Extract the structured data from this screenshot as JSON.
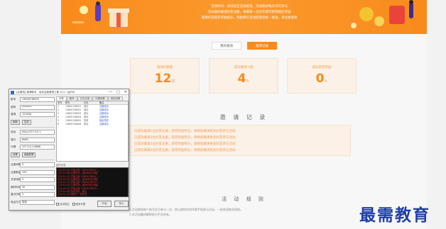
{
  "banner": {
    "lines": [
      "活动时间：即日起至活动结束，活动期间每天均可参与",
      "活动期间邀请好友注册，每邀请一位好友即可获得相应奖励",
      "邀请好友越多奖励越多，奖励将在活动结束后统一发放，请注意查收"
    ]
  },
  "tabs": [
    "我的邀请",
    "邀请记录"
  ],
  "stats": [
    {
      "label": "邀请码数量",
      "value": "12",
      "unit": "次"
    },
    {
      "label": "成功邀请人数",
      "value": "4",
      "unit": "人"
    },
    {
      "label": "成功获得奖励",
      "value": "0",
      "unit": "人"
    }
  ],
  "records_title": "邀 请 记 录",
  "records": [
    "已成功邀请1位好友注册，获得奖励积分，请继续邀请更多好友参与活动",
    "已成功邀请2位好友注册，获得奖励积分，请继续邀请更多好友参与活动",
    "已成功邀请3位好友注册，获得奖励积分，请继续邀请更多好友参与活动",
    "已成功邀请4位好友注册，获得奖励积分，请继续邀请更多好友参与活动"
  ],
  "system_title": "活 动 规 则",
  "system_lines": [
    "1.活动期间每个账号仅可参与一次，禁止使用任何作弊手段参与活动，一经发现取消资格。",
    "2.本活动最终解释权归平台所有。"
  ],
  "watermark": "最需教育",
  "window": {
    "title": "[注册机] 邀请助手 - 自动注册邀请工具 v1.0 - 运行中",
    "controls": [
      "—",
      "□",
      "✕"
    ],
    "fields": [
      {
        "k": "账号",
        "v": "13800138000"
      },
      {
        "k": "密码",
        "v": "********"
      },
      {
        "k": "邀请",
        "v": "123456"
      }
    ],
    "refresh_label": "刷新",
    "gen_label": "生成",
    "fields2": [
      {
        "k": "地址",
        "v": "http://127.0.0.1"
      },
      {
        "k": "端口",
        "v": "8080"
      }
    ],
    "proxy": {
      "k": "代理",
      "v": "127.0.0.1:8888"
    },
    "set_label": "设置",
    "config_label": "读取配置",
    "counts": [
      {
        "k": "注册间隔",
        "v": "3"
      },
      {
        "k": "注册数量",
        "v": "100"
      },
      {
        "k": "并发线程",
        "v": "5"
      },
      {
        "k": "超时时间",
        "v": "30"
      },
      {
        "k": "重试次数",
        "v": "3"
      },
      {
        "k": "验证方式",
        "v": "短信"
      }
    ],
    "tabs": [
      "列表",
      "账号",
      "日志记录",
      "代理设置",
      "其他设置"
    ],
    "grid_headers": [
      "序号",
      "账号",
      "状态",
      "备注"
    ],
    "grid_rows": [
      [
        "1",
        "13800138001",
        "成功",
        "注册成功"
      ],
      [
        "2",
        "13800138002",
        "成功",
        "注册成功"
      ],
      [
        "3",
        "13800138003",
        "成功",
        "注册成功"
      ],
      [
        "4",
        "13800138004",
        "成功",
        "注册成功"
      ],
      [
        "5",
        "13800138005",
        "失败",
        "验证失败"
      ],
      [
        "6",
        "13800138006",
        "成功",
        "注册成功"
      ]
    ],
    "log_label": "运行日志",
    "console_lines": [
      "[12:01:05] 开始注册 13800138001 ...",
      "[12:01:08] 注册成功，邀请关系已绑定",
      "[12:01:11] 开始注册 13800138002 ...",
      "[12:01:14] 注册成功，邀请关系已绑定",
      "[12:01:17] 开始注册 13800138003 ...",
      "[12:01:20] 注册成功，邀请关系已绑定",
      "[12:01:23] 开始注册 13800138005 ...",
      "[12:01:26] 验证失败，跳过",
      "[12:01:29] 等待下一轮任务 ..."
    ],
    "check1": "自动验证",
    "check2": "使用代理",
    "start_label": "开始",
    "stop_label": "停止"
  },
  "colors": {
    "accent": "#f98a1c",
    "card_bg": "#fbf1e6",
    "watermark": "#1f3fa8",
    "console_text": "#e43a3a"
  }
}
